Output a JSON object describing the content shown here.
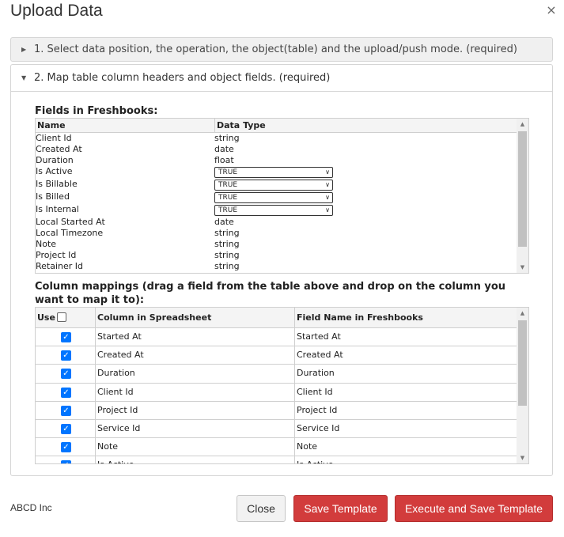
{
  "dialog": {
    "title": "Upload Data",
    "close_glyph": "×"
  },
  "steps": [
    {
      "label": "1. Select data position, the operation, the object(table) and the upload/push mode. (required)",
      "expanded": false
    },
    {
      "label": "2. Map table column headers and object fields. (required)",
      "expanded": true
    }
  ],
  "fields_section": {
    "title": "Fields in Freshbooks:",
    "headers": {
      "name": "Name",
      "type": "Data Type"
    },
    "rows": [
      {
        "name": "Client Id",
        "type": "string"
      },
      {
        "name": "Created At",
        "type": "date"
      },
      {
        "name": "Duration",
        "type": "float"
      },
      {
        "name": "Is Active",
        "type": "TRUE",
        "is_select": true
      },
      {
        "name": "Is Billable",
        "type": "TRUE",
        "is_select": true
      },
      {
        "name": "Is Billed",
        "type": "TRUE",
        "is_select": true
      },
      {
        "name": "Is Internal",
        "type": "TRUE",
        "is_select": true
      },
      {
        "name": "Local Started At",
        "type": "date"
      },
      {
        "name": "Local Timezone",
        "type": "string"
      },
      {
        "name": "Note",
        "type": "string"
      },
      {
        "name": "Project Id",
        "type": "string"
      },
      {
        "name": "Retainer Id",
        "type": "string"
      }
    ]
  },
  "mapping_section": {
    "title": "Column mappings (drag a field from the table above and drop on the column you want to map it to):",
    "headers": {
      "use": "Use",
      "column": "Column in Spreadsheet",
      "field": "Field Name in Freshbooks"
    },
    "rows": [
      {
        "checked": true,
        "column": "Started At",
        "field": "Started At"
      },
      {
        "checked": true,
        "column": "Created At",
        "field": "Created At"
      },
      {
        "checked": true,
        "column": "Duration",
        "field": "Duration"
      },
      {
        "checked": true,
        "column": "Client Id",
        "field": "Client Id"
      },
      {
        "checked": true,
        "column": "Project Id",
        "field": "Project Id"
      },
      {
        "checked": true,
        "column": "Service Id",
        "field": "Service Id"
      },
      {
        "checked": true,
        "column": "Note",
        "field": "Note"
      },
      {
        "checked": true,
        "column": "Is Active",
        "field": "Is Active"
      }
    ]
  },
  "footer": {
    "company": "ABCD Inc",
    "close_label": "Close",
    "save_label": "Save Template",
    "execute_label": "Execute and Save Template"
  },
  "colors": {
    "primary_button": "#d23c3c",
    "checkbox": "#0075ff"
  }
}
